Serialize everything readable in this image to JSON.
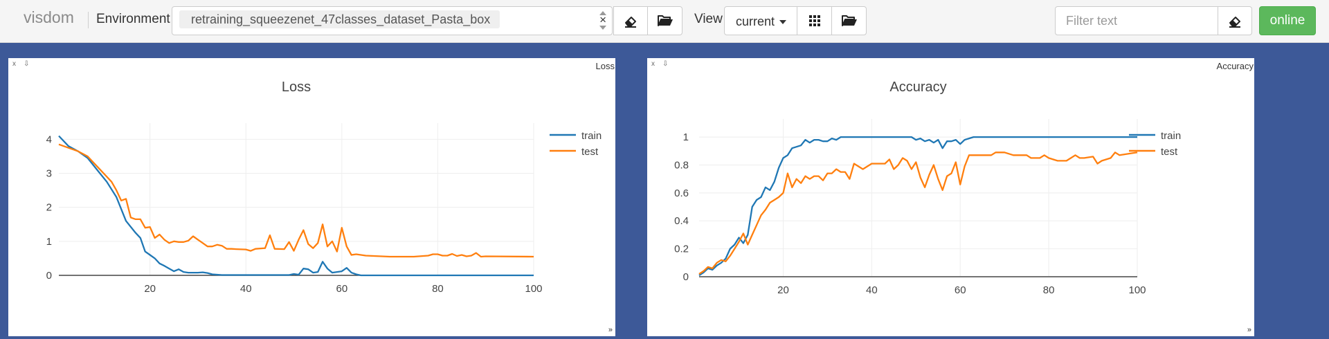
{
  "navbar": {
    "brand": "visdom",
    "environment_label": "Environment",
    "environment_selected": "retraining_squeezenet_47classes_dataset_Pasta_box",
    "clear_symbol": "×",
    "view_label": "View",
    "view_selected": "current",
    "filter_placeholder": "Filter text",
    "online_label": "online"
  },
  "icons": {
    "eraser": "eraser-icon",
    "folder": "folder-open-icon",
    "grid": "grid-icon",
    "resize": "resize-icon"
  },
  "panes": [
    {
      "close_symbol": "x",
      "pin_symbol": "⇩",
      "window_title": "Loss",
      "resize_symbol": "»",
      "chart_data": {
        "type": "line",
        "title": "Loss",
        "xlim": [
          1,
          100
        ],
        "ylim": [
          0,
          4.15
        ],
        "xticks": [
          20,
          40,
          60,
          80,
          100
        ],
        "yticks": [
          0,
          1,
          2,
          3,
          4
        ],
        "legend_position": "top-right",
        "grid": true,
        "series": [
          {
            "name": "train",
            "color": "#1f77b4",
            "x": [
              1,
              3,
              5,
              7,
              9,
              11,
              13,
              15,
              17,
              18,
              19,
              20,
              21,
              22,
              23,
              24,
              25,
              26,
              27,
              28,
              29,
              30,
              31,
              32,
              33,
              35,
              40,
              45,
              49,
              50,
              51,
              52,
              53,
              54,
              55,
              56,
              57,
              58,
              59,
              60,
              61,
              62,
              63,
              64,
              65,
              70,
              80,
              90,
              100
            ],
            "y": [
              4.1,
              3.8,
              3.65,
              3.45,
              3.1,
              2.75,
              2.3,
              1.6,
              1.25,
              1.1,
              0.7,
              0.6,
              0.5,
              0.35,
              0.28,
              0.2,
              0.12,
              0.18,
              0.1,
              0.08,
              0.08,
              0.08,
              0.09,
              0.07,
              0.03,
              0.01,
              0.01,
              0.01,
              0.01,
              0.04,
              0.02,
              0.2,
              0.18,
              0.08,
              0.1,
              0.4,
              0.2,
              0.08,
              0.1,
              0.12,
              0.22,
              0.08,
              0.03,
              0.0,
              0.0,
              0.0,
              0.0,
              0.0,
              0.0
            ]
          },
          {
            "name": "test",
            "color": "#ff7f0e",
            "x": [
              1,
              3,
              5,
              7,
              9,
              11,
              12,
              13,
              14,
              15,
              16,
              17,
              18,
              19,
              20,
              21,
              22,
              23,
              24,
              25,
              26,
              27,
              28,
              29,
              30,
              31,
              32,
              33,
              34,
              35,
              36,
              37,
              38,
              40,
              41,
              42,
              44,
              45,
              46,
              48,
              49,
              50,
              51,
              52,
              53,
              54,
              55,
              56,
              57,
              58,
              59,
              60,
              61,
              62,
              63,
              65,
              70,
              75,
              78,
              79,
              80,
              81,
              82,
              83,
              84,
              85,
              86,
              87,
              88,
              89,
              90,
              100
            ],
            "y": [
              3.85,
              3.75,
              3.65,
              3.5,
              3.2,
              2.9,
              2.75,
              2.5,
              2.2,
              2.25,
              1.7,
              1.65,
              1.65,
              1.4,
              1.42,
              1.1,
              1.2,
              1.05,
              0.95,
              1.0,
              0.98,
              0.98,
              1.02,
              1.15,
              1.05,
              0.95,
              0.85,
              0.85,
              0.9,
              0.87,
              0.78,
              0.78,
              0.77,
              0.76,
              0.72,
              0.78,
              0.8,
              1.18,
              0.78,
              0.77,
              0.98,
              0.72,
              1.05,
              1.33,
              0.92,
              0.8,
              0.95,
              1.5,
              0.85,
              1.0,
              0.7,
              1.4,
              0.85,
              0.6,
              0.62,
              0.58,
              0.55,
              0.55,
              0.58,
              0.62,
              0.62,
              0.58,
              0.58,
              0.63,
              0.57,
              0.6,
              0.56,
              0.58,
              0.66,
              0.55,
              0.56,
              0.55
            ]
          }
        ]
      }
    },
    {
      "close_symbol": "x",
      "pin_symbol": "⇩",
      "window_title": "Accuracy",
      "resize_symbol": "»",
      "chart_data": {
        "type": "line",
        "title": "Accuracy",
        "xlim": [
          1,
          100
        ],
        "ylim": [
          0,
          1.05
        ],
        "xticks": [
          20,
          40,
          60,
          80,
          100
        ],
        "yticks": [
          0,
          0.2,
          0.4,
          0.6,
          0.8,
          1
        ],
        "legend_position": "top-right",
        "grid": true,
        "series": [
          {
            "name": "train",
            "color": "#1f77b4",
            "x": [
              1,
              2,
              3,
              4,
              5,
              6,
              7,
              8,
              9,
              10,
              11,
              12,
              13,
              14,
              15,
              16,
              17,
              18,
              19,
              20,
              21,
              22,
              23,
              24,
              25,
              26,
              27,
              28,
              29,
              30,
              31,
              32,
              33,
              35,
              40,
              45,
              49,
              50,
              51,
              52,
              53,
              54,
              55,
              56,
              57,
              58,
              59,
              60,
              61,
              62,
              63,
              65,
              70,
              80,
              90,
              100
            ],
            "y": [
              0.01,
              0.03,
              0.06,
              0.05,
              0.08,
              0.1,
              0.13,
              0.2,
              0.23,
              0.28,
              0.24,
              0.3,
              0.5,
              0.55,
              0.57,
              0.64,
              0.62,
              0.68,
              0.78,
              0.85,
              0.87,
              0.92,
              0.93,
              0.94,
              0.98,
              0.96,
              0.98,
              0.98,
              0.97,
              0.97,
              0.99,
              0.98,
              1.0,
              1.0,
              1.0,
              1.0,
              1.0,
              0.98,
              0.99,
              0.97,
              0.98,
              0.96,
              0.98,
              0.92,
              0.97,
              0.97,
              0.98,
              0.95,
              0.98,
              0.99,
              1.0,
              1.0,
              1.0,
              1.0,
              1.0,
              1.0
            ]
          },
          {
            "name": "test",
            "color": "#ff7f0e",
            "x": [
              1,
              2,
              3,
              4,
              5,
              6,
              7,
              8,
              9,
              10,
              11,
              12,
              13,
              14,
              15,
              16,
              17,
              18,
              19,
              20,
              21,
              22,
              23,
              24,
              25,
              26,
              27,
              28,
              29,
              30,
              31,
              32,
              33,
              34,
              35,
              36,
              37,
              38,
              39,
              40,
              42,
              43,
              44,
              45,
              46,
              47,
              48,
              49,
              50,
              51,
              52,
              53,
              54,
              55,
              56,
              57,
              58,
              59,
              60,
              61,
              62,
              63,
              65,
              67,
              68,
              69,
              70,
              72,
              74,
              75,
              76,
              78,
              79,
              80,
              82,
              83,
              84,
              85,
              86,
              87,
              88,
              90,
              91,
              92,
              94,
              95,
              96,
              100
            ],
            "y": [
              0.02,
              0.04,
              0.07,
              0.06,
              0.1,
              0.12,
              0.11,
              0.15,
              0.2,
              0.25,
              0.31,
              0.23,
              0.3,
              0.37,
              0.44,
              0.48,
              0.53,
              0.55,
              0.57,
              0.6,
              0.74,
              0.64,
              0.7,
              0.67,
              0.72,
              0.7,
              0.72,
              0.72,
              0.69,
              0.74,
              0.74,
              0.77,
              0.75,
              0.75,
              0.7,
              0.81,
              0.79,
              0.77,
              0.79,
              0.81,
              0.81,
              0.81,
              0.84,
              0.77,
              0.8,
              0.85,
              0.83,
              0.77,
              0.82,
              0.71,
              0.64,
              0.73,
              0.8,
              0.7,
              0.62,
              0.72,
              0.74,
              0.82,
              0.66,
              0.79,
              0.87,
              0.87,
              0.87,
              0.87,
              0.89,
              0.89,
              0.89,
              0.87,
              0.87,
              0.87,
              0.85,
              0.85,
              0.87,
              0.85,
              0.83,
              0.83,
              0.83,
              0.85,
              0.87,
              0.85,
              0.85,
              0.86,
              0.81,
              0.83,
              0.85,
              0.89,
              0.87,
              0.89
            ]
          }
        ]
      }
    }
  ]
}
